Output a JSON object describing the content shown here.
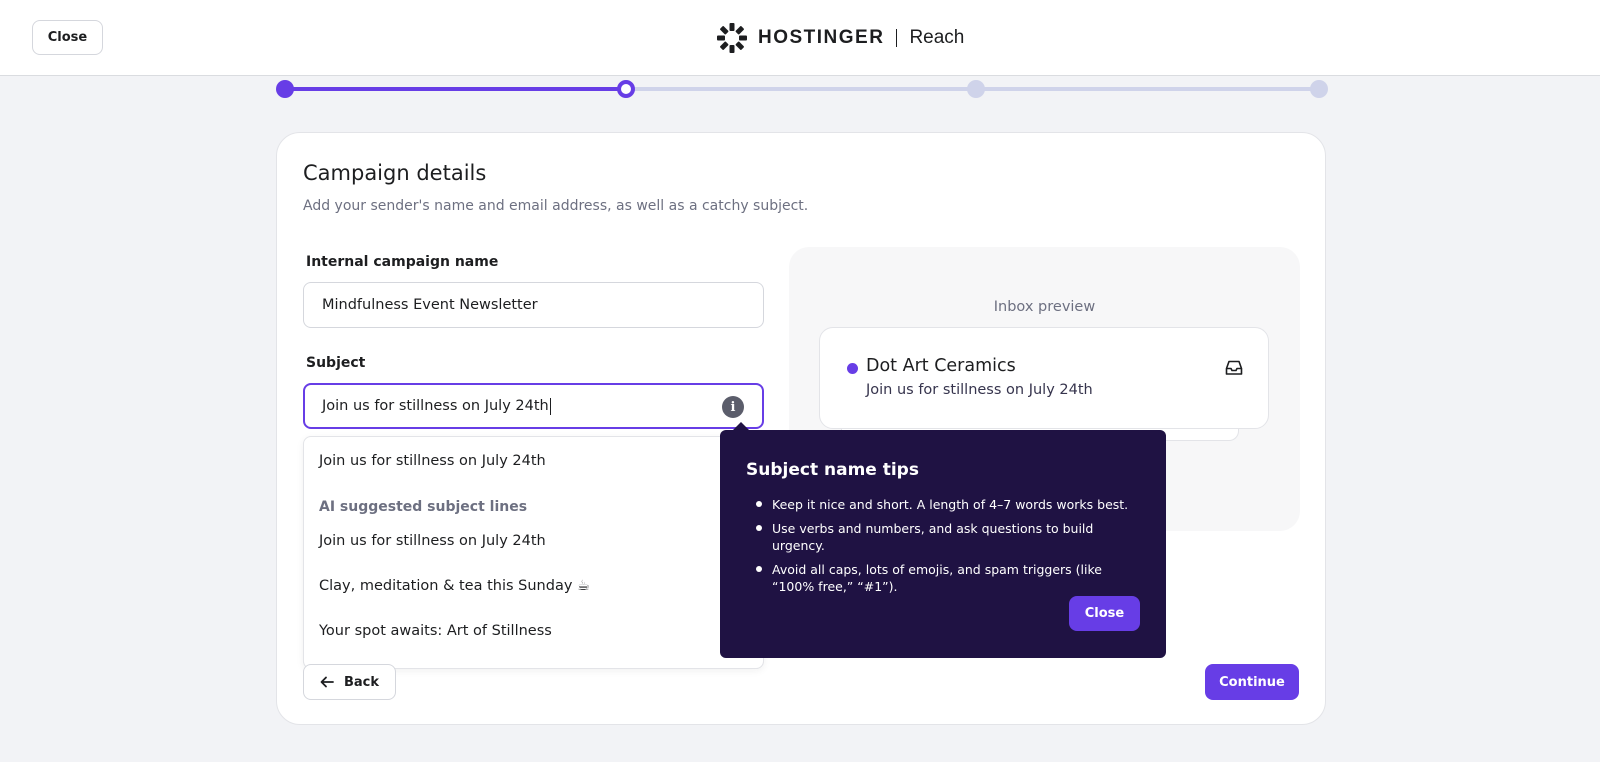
{
  "header": {
    "close_label": "Close",
    "brand_name": "HOSTINGER",
    "brand_product": "Reach"
  },
  "stepper": {
    "total_steps": 4,
    "current_step": 2,
    "colors": {
      "done": "#673de6",
      "pending": "#cfd3ea"
    }
  },
  "campaign": {
    "title": "Campaign details",
    "subtitle": "Add your sender's name and email address, as well as a catchy subject.",
    "internal_name_label": "Internal campaign name",
    "internal_name_value": "Mindfulness Event Newsletter",
    "subject_label": "Subject",
    "subject_value": "Join us for stillness on July 24th"
  },
  "subject_dropdown": {
    "current": "Join us for stillness on July 24th",
    "ai_header": "AI suggested subject lines",
    "suggestions": [
      "Join us for stillness on July 24th",
      "Clay, meditation & tea this Sunday ☕",
      "Your spot awaits: Art of Stillness"
    ]
  },
  "inbox_preview": {
    "label": "Inbox preview",
    "sender": "Dot Art Ceramics",
    "subject": "Join us for stillness on July 24th"
  },
  "tooltip": {
    "title": "Subject name tips",
    "tips": [
      "Keep it nice and short. A length of 4–7 words works best.",
      "Use verbs and numbers, and ask questions to build urgency.",
      "Avoid all caps, lots of emojis, and spam triggers (like “100% free,” “#1”)."
    ],
    "close_label": "Close"
  },
  "footer": {
    "back_label": "Back",
    "continue_label": "Continue"
  },
  "colors": {
    "accent": "#673de6",
    "tooltip_bg": "#1f1243",
    "page_bg": "#f2f3f6"
  }
}
